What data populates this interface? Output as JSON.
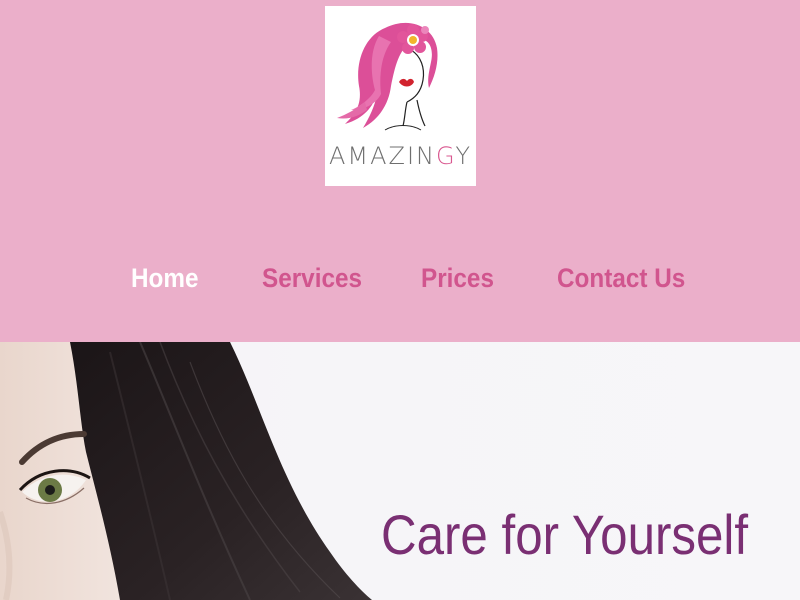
{
  "brand": {
    "logo_letters": [
      "AMAZIN",
      "G",
      "Y"
    ],
    "logo_icon": "woman-with-flower-icon"
  },
  "nav": {
    "items": [
      {
        "label": "Home",
        "active": true
      },
      {
        "label": "Services",
        "active": false
      },
      {
        "label": "Prices",
        "active": false
      },
      {
        "label": "Contact Us",
        "active": false
      }
    ]
  },
  "hero": {
    "title": "Care for Yourself",
    "image": "woman-dark-hair-photo"
  },
  "colors": {
    "header_bg": "#ebafca",
    "nav_text": "#d1558e",
    "nav_active": "#ffffff",
    "hero_title": "#7a2f73",
    "logo_accent": "#d9578f"
  }
}
